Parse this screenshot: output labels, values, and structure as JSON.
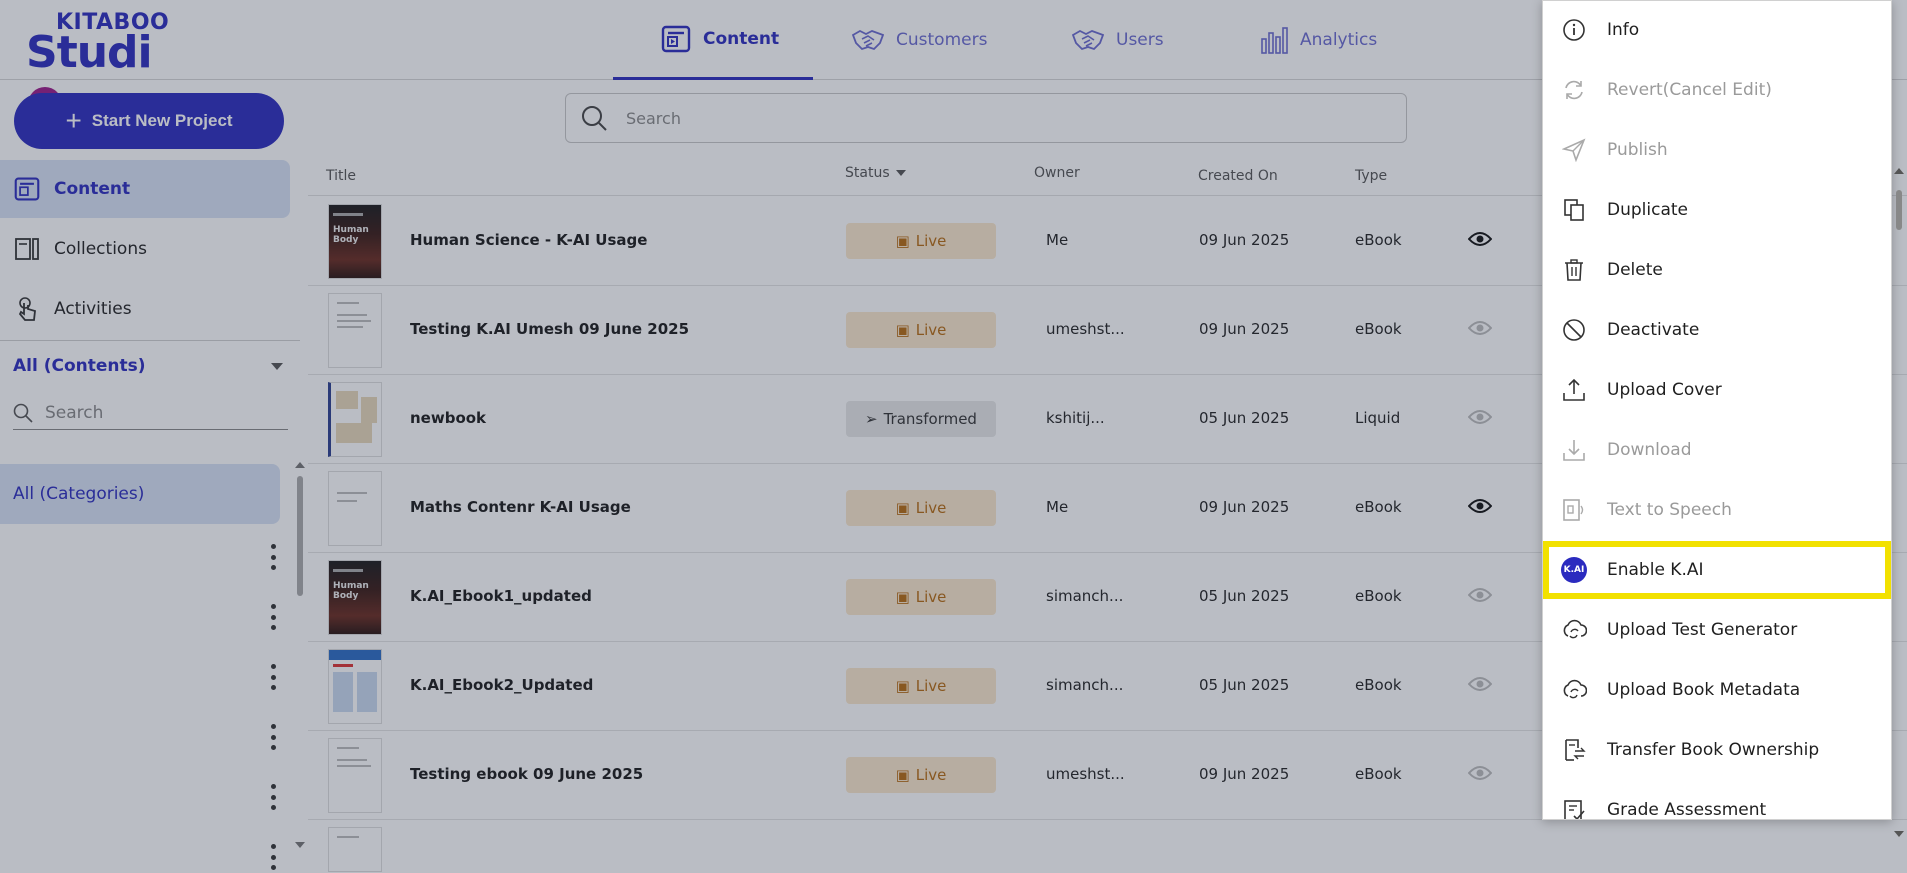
{
  "header": {
    "logo_top": "KITABOO",
    "logo_bottom": "Studi",
    "tabs": [
      {
        "label": "Content",
        "icon": "content-icon",
        "active": true
      },
      {
        "label": "Customers",
        "icon": "handshake-icon"
      },
      {
        "label": "Users",
        "icon": "handshake-icon"
      },
      {
        "label": "Analytics",
        "icon": "bar-chart-icon"
      }
    ]
  },
  "toolbar": {
    "new_project_label": "Start New Project",
    "search_placeholder": "Search"
  },
  "sidebar": {
    "items": [
      {
        "label": "Content",
        "icon": "content-icon",
        "active": true
      },
      {
        "label": "Collections",
        "icon": "collections-icon"
      },
      {
        "label": "Activities",
        "icon": "touch-icon"
      }
    ],
    "filter_label": "All (Contents)",
    "search_placeholder": "Search",
    "category_label": "All (Categories)"
  },
  "table": {
    "headers": {
      "title": "Title",
      "status": "Status",
      "owner": "Owner",
      "created_on": "Created On",
      "type": "Type"
    },
    "rows": [
      {
        "title": "Human Science - K-AI Usage",
        "status": "Live",
        "owner": "Me",
        "created_on": "09 Jun 2025",
        "type": "eBook",
        "thumb_text": "Human Body"
      },
      {
        "title": "Testing K.AI Umesh 09 June 2025",
        "status": "Live",
        "owner": "umeshst...",
        "created_on": "09 Jun 2025",
        "type": "eBook"
      },
      {
        "title": "newbook",
        "status": "Transformed",
        "owner": "kshitij...",
        "created_on": "05 Jun 2025",
        "type": "Liquid"
      },
      {
        "title": "Maths Contenr K-AI Usage",
        "status": "Live",
        "owner": "Me",
        "created_on": "09 Jun 2025",
        "type": "eBook"
      },
      {
        "title": "K.AI_Ebook1_updated",
        "status": "Live",
        "owner": "simanch...",
        "created_on": "05 Jun 2025",
        "type": "eBook",
        "thumb_text": "Human Body"
      },
      {
        "title": "K.AI_Ebook2_Updated",
        "status": "Live",
        "owner": "simanch...",
        "created_on": "05 Jun 2025",
        "type": "eBook"
      },
      {
        "title": "Testing ebook 09 June 2025",
        "status": "Live",
        "owner": "umeshst...",
        "created_on": "09 Jun 2025",
        "type": "eBook"
      }
    ]
  },
  "context_menu": {
    "items": [
      {
        "label": "Info",
        "icon": "info-icon",
        "disabled": false
      },
      {
        "label": "Revert(Cancel Edit)",
        "icon": "revert-icon",
        "disabled": true
      },
      {
        "label": "Publish",
        "icon": "send-icon",
        "disabled": true
      },
      {
        "label": "Duplicate",
        "icon": "duplicate-icon",
        "disabled": false
      },
      {
        "label": "Delete",
        "icon": "trash-icon",
        "disabled": false
      },
      {
        "label": "Deactivate",
        "icon": "block-icon",
        "disabled": false
      },
      {
        "label": "Upload Cover",
        "icon": "upload-icon",
        "disabled": false
      },
      {
        "label": "Download",
        "icon": "download-icon",
        "disabled": true
      },
      {
        "label": "Text to Speech",
        "icon": "text-to-speech-icon",
        "disabled": true
      },
      {
        "label": "Enable K.AI",
        "icon": "kai-icon",
        "disabled": false,
        "highlighted": true,
        "badge": "K.AI"
      },
      {
        "label": "Upload Test Generator",
        "icon": "cloud-sync-icon",
        "disabled": false
      },
      {
        "label": "Upload Book Metadata",
        "icon": "cloud-sync-icon",
        "disabled": false
      },
      {
        "label": "Transfer Book Ownership",
        "icon": "transfer-icon",
        "disabled": false
      },
      {
        "label": "Grade Assessment",
        "icon": "grade-icon",
        "disabled": false
      }
    ]
  },
  "colors": {
    "brand": "#2b2bbf",
    "logo_accent": "#9b1a8a",
    "live_badge_bg": "#fbe8cc",
    "live_badge_text": "#b66a10",
    "highlight": "#f2e100"
  }
}
